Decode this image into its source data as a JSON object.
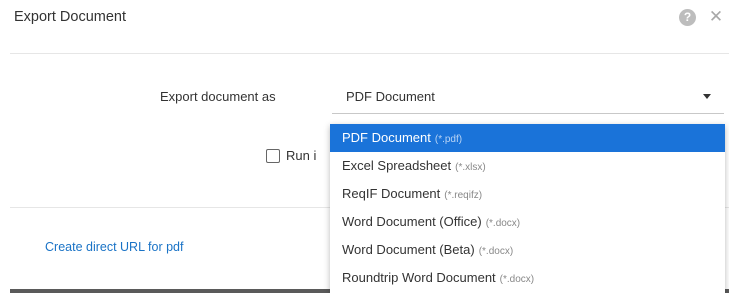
{
  "dialog": {
    "title": "Export Document",
    "help_icon": "question-icon",
    "close_icon": "close-icon"
  },
  "form": {
    "export_label": "Export document as",
    "selected_value": "PDF Document",
    "run_label_partial": "Run i",
    "run_checked": false
  },
  "dropdown": {
    "selected_index": 0,
    "items": [
      {
        "label": "PDF Document",
        "ext": "(*.pdf)"
      },
      {
        "label": "Excel Spreadsheet",
        "ext": "(*.xlsx)"
      },
      {
        "label": "ReqIF Document",
        "ext": "(*.reqifz)"
      },
      {
        "label": "Word Document (Office)",
        "ext": "(*.docx)"
      },
      {
        "label": "Word Document (Beta)",
        "ext": "(*.docx)"
      },
      {
        "label": "Roundtrip Word Document",
        "ext": "(*.docx)"
      }
    ]
  },
  "footer": {
    "url_link": "Create direct URL for pdf"
  },
  "colors": {
    "accent": "#1a73d9",
    "link": "#1a73c6"
  }
}
